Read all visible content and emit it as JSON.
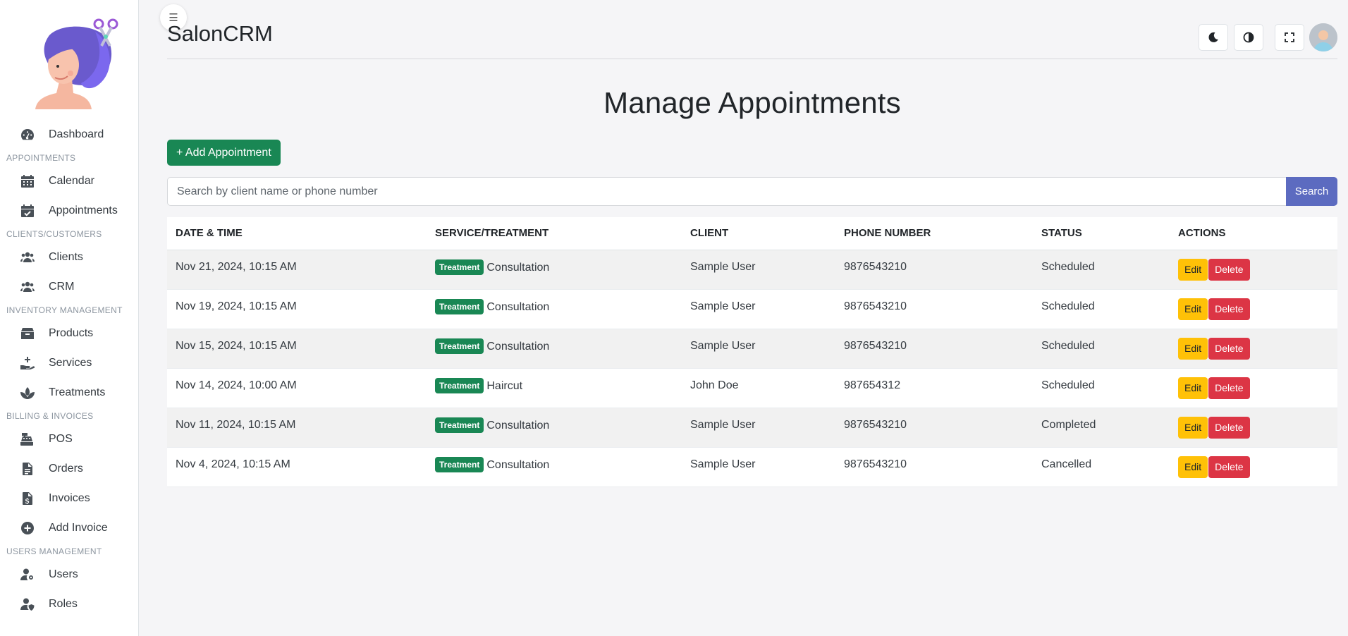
{
  "app": {
    "title": "SalonCRM",
    "menu_toggle_glyph": "☰"
  },
  "sidebar": {
    "items": [
      {
        "type": "item",
        "label": "Dashboard",
        "icon": "dashboard-gauge-icon"
      },
      {
        "type": "section",
        "label": "APPOINTMENTS"
      },
      {
        "type": "item",
        "label": "Calendar",
        "icon": "calendar-icon"
      },
      {
        "type": "item",
        "label": "Appointments",
        "icon": "calendar-check-icon"
      },
      {
        "type": "section",
        "label": "CLIENTS/CUSTOMERS"
      },
      {
        "type": "item",
        "label": "Clients",
        "icon": "users-icon"
      },
      {
        "type": "item",
        "label": "CRM",
        "icon": "users-icon"
      },
      {
        "type": "section",
        "label": "INVENTORY MANAGEMENT"
      },
      {
        "type": "item",
        "label": "Products",
        "icon": "box-icon"
      },
      {
        "type": "item",
        "label": "Services",
        "icon": "hand-holding-plus-icon"
      },
      {
        "type": "item",
        "label": "Treatments",
        "icon": "spa-icon"
      },
      {
        "type": "section",
        "label": "BILLING & INVOICES"
      },
      {
        "type": "item",
        "label": "POS",
        "icon": "cash-register-icon"
      },
      {
        "type": "item",
        "label": "Orders",
        "icon": "file-lines-icon"
      },
      {
        "type": "item",
        "label": "Invoices",
        "icon": "file-invoice-dollar-icon"
      },
      {
        "type": "item",
        "label": "Add Invoice",
        "icon": "circle-plus-icon"
      },
      {
        "type": "section",
        "label": "USERS MANAGEMENT"
      },
      {
        "type": "item",
        "label": "Users",
        "icon": "user-gear-icon"
      },
      {
        "type": "item",
        "label": "Roles",
        "icon": "user-shield-icon"
      }
    ]
  },
  "toolbar": {
    "icons": [
      "moon-icon",
      "contrast-icon",
      "fullscreen-icon",
      "user-avatar-icon"
    ]
  },
  "main": {
    "title": "Manage Appointments",
    "add_button_label": "+ Add Appointment",
    "search": {
      "placeholder": "Search by client name or phone number",
      "value": "",
      "button_label": "Search"
    },
    "table": {
      "columns": [
        "DATE & TIME",
        "SERVICE/TREATMENT",
        "CLIENT",
        "PHONE NUMBER",
        "STATUS",
        "ACTIONS"
      ],
      "badge_label": "Treatment",
      "edit_label": "Edit",
      "delete_label": "Delete",
      "rows": [
        {
          "datetime": "Nov 21, 2024, 10:15 AM",
          "service": "Consultation",
          "client": "Sample User",
          "phone": "9876543210",
          "status": "Scheduled"
        },
        {
          "datetime": "Nov 19, 2024, 10:15 AM",
          "service": "Consultation",
          "client": "Sample User",
          "phone": "9876543210",
          "status": "Scheduled"
        },
        {
          "datetime": "Nov 15, 2024, 10:15 AM",
          "service": "Consultation",
          "client": "Sample User",
          "phone": "9876543210",
          "status": "Scheduled"
        },
        {
          "datetime": "Nov 14, 2024, 10:00 AM",
          "service": "Haircut",
          "client": "John Doe",
          "phone": "987654312",
          "status": "Scheduled"
        },
        {
          "datetime": "Nov 11, 2024, 10:15 AM",
          "service": "Consultation",
          "client": "Sample User",
          "phone": "9876543210",
          "status": "Completed"
        },
        {
          "datetime": "Nov 4, 2024, 10:15 AM",
          "service": "Consultation",
          "client": "Sample User",
          "phone": "9876543210",
          "status": "Cancelled"
        }
      ]
    }
  },
  "colors": {
    "primary_green": "#198754",
    "search_button": "#5c6bc0",
    "edit_button": "#ffc107",
    "delete_button": "#dc3545"
  }
}
